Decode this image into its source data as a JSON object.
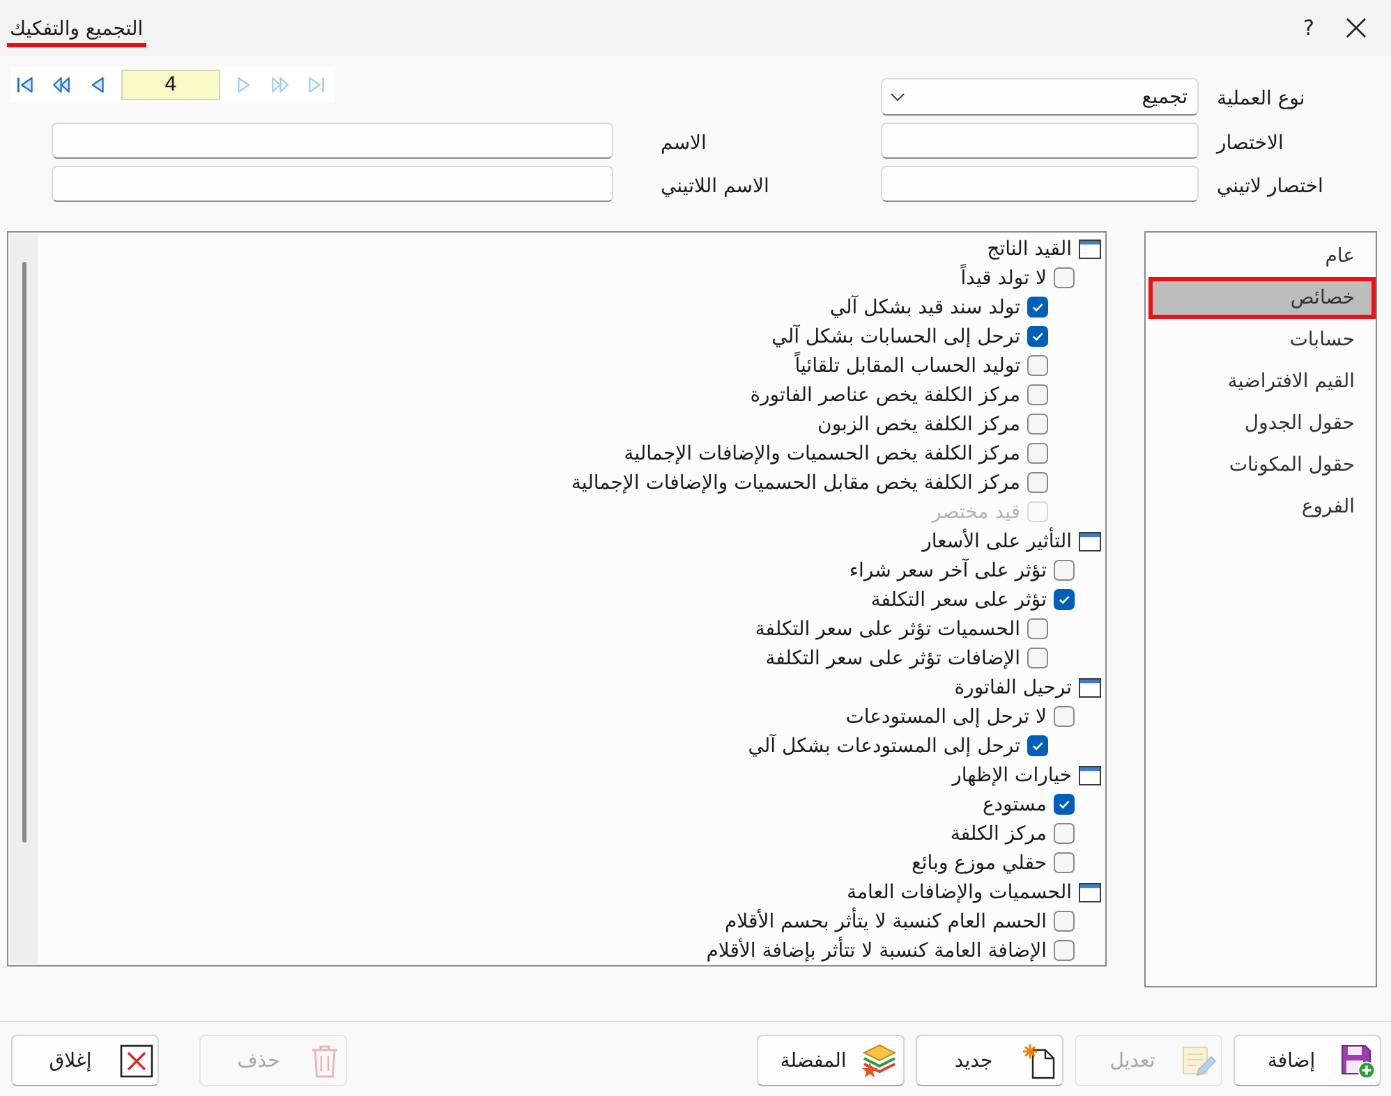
{
  "window": {
    "title": "التجميع والتفكيك",
    "help": "?"
  },
  "navigator": {
    "items": [
      {
        "kind": "first",
        "disabled": false
      },
      {
        "kind": "rewind",
        "disabled": false
      },
      {
        "kind": "previous",
        "disabled": false
      },
      {
        "kind": "record",
        "value": "4",
        "disabled": false
      },
      {
        "kind": "next",
        "disabled": true
      },
      {
        "kind": "fast-forward",
        "disabled": true
      },
      {
        "kind": "last",
        "disabled": true
      }
    ]
  },
  "form": {
    "rows": [
      [
        {
          "kind": "dropdown",
          "label": "نوع العملية",
          "value": "تجميع"
        }
      ],
      [
        {
          "kind": "text",
          "label": "الاختصار"
        },
        {
          "kind": "text",
          "label": "الاسم"
        }
      ],
      [
        {
          "kind": "text",
          "label": "اختصار لاتيني"
        },
        {
          "kind": "text",
          "label": "الاسم اللاتيني"
        }
      ]
    ]
  },
  "options": {
    "groups": [
      {
        "title": "القيد الناتج",
        "items": [
          {
            "label": "لا تولد قيداً",
            "checked": false,
            "disabled": false,
            "children": [
              {
                "label": "تولد سند قيد بشكل آلي",
                "checked": true,
                "disabled": false
              },
              {
                "label": "ترحل إلى الحسابات بشكل آلي",
                "checked": true,
                "disabled": false
              },
              {
                "label": "توليد الحساب المقابل تلقائياً",
                "checked": false,
                "disabled": false
              },
              {
                "label": "مركز الكلفة يخص عناصر الفاتورة",
                "checked": false,
                "disabled": false
              },
              {
                "label": "مركز الكلفة يخص الزبون",
                "checked": false,
                "disabled": false
              },
              {
                "label": "مركز الكلفة يخص الحسميات والإضافات الإجمالية",
                "checked": false,
                "disabled": false
              },
              {
                "label": "مركز الكلفة يخص مقابل الحسميات والإضافات الإجمالية",
                "checked": false,
                "disabled": false
              },
              {
                "label": "قيد مختصر",
                "checked": false,
                "disabled": true
              }
            ]
          }
        ]
      },
      {
        "title": "التأثير على الأسعار",
        "items": [
          {
            "label": "تؤثر على آخر سعر شراء",
            "checked": false,
            "disabled": false
          },
          {
            "label": "تؤثر على سعر التكلفة",
            "checked": true,
            "disabled": false,
            "children": [
              {
                "label": "الحسميات تؤثر على سعر التكلفة",
                "checked": false,
                "disabled": false
              },
              {
                "label": "الإضافات تؤثر على سعر التكلفة",
                "checked": false,
                "disabled": false
              }
            ]
          }
        ]
      },
      {
        "title": "ترحيل الفاتورة",
        "items": [
          {
            "label": "لا ترحل إلى المستودعات",
            "checked": false,
            "disabled": false,
            "children": [
              {
                "label": "ترحل إلى المستودعات بشكل آلي",
                "checked": true,
                "disabled": false
              }
            ]
          }
        ]
      },
      {
        "title": "خيارات الإظهار",
        "items": [
          {
            "label": "مستودع",
            "checked": true,
            "disabled": false
          },
          {
            "label": "مركز الكلفة",
            "checked": false,
            "disabled": false
          },
          {
            "label": "حقلي موزع وبائع",
            "checked": false,
            "disabled": false
          }
        ]
      },
      {
        "title": "الحسميات والإضافات العامة",
        "items": [
          {
            "label": "الحسم العام كنسبة لا يتأثر بحسم الأقلام",
            "checked": false,
            "disabled": false
          },
          {
            "label": "الإضافة العامة كنسبة لا تتأثر بإضافة الأقلام",
            "checked": false,
            "disabled": false
          }
        ]
      }
    ]
  },
  "sidebar": {
    "items": [
      {
        "label": "عام",
        "selected": false
      },
      {
        "label": "خصائص",
        "selected": true
      },
      {
        "label": "حسابات",
        "selected": false
      },
      {
        "label": "القيم الافتراضية",
        "selected": false
      },
      {
        "label": "حقول الجدول",
        "selected": false
      },
      {
        "label": "حقول المكونات",
        "selected": false
      },
      {
        "label": "الفروع",
        "selected": false
      }
    ]
  },
  "buttons": [
    {
      "kind": "add",
      "label": "إضافة",
      "disabled": false
    },
    {
      "kind": "edit",
      "label": "تعديل",
      "disabled": true
    },
    {
      "kind": "new",
      "label": "جديد",
      "disabled": false
    },
    {
      "kind": "favorites",
      "label": "المفضلة",
      "disabled": false
    },
    {
      "kind": "delete",
      "label": "حذف",
      "disabled": true
    },
    {
      "kind": "close",
      "label": "إغلاق",
      "disabled": false
    }
  ]
}
